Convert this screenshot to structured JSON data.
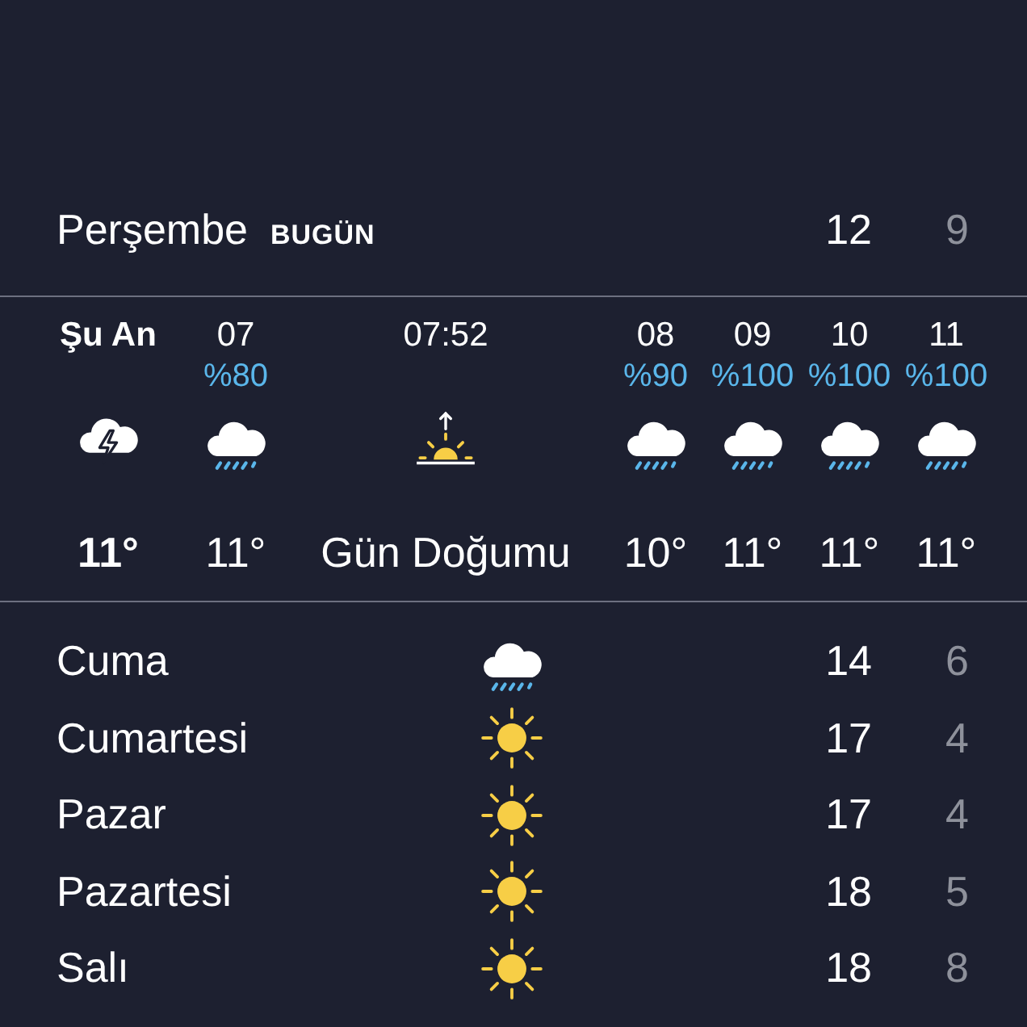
{
  "today": {
    "day": "Perşembe",
    "badge": "BUGÜN",
    "high": "12",
    "low": "9"
  },
  "hourly": [
    {
      "kind": "thunderstorm",
      "current": true,
      "time": "Şu An",
      "temp": "11°"
    },
    {
      "kind": "rain",
      "current": false,
      "time": "07",
      "chance": "%80",
      "temp": "11°"
    },
    {
      "kind": "sunrise",
      "current": false,
      "time": "07:52",
      "temp": "Gün Doğumu"
    },
    {
      "kind": "rain",
      "current": false,
      "time": "08",
      "chance": "%90",
      "temp": "10°"
    },
    {
      "kind": "rain",
      "current": false,
      "time": "09",
      "chance": "%100",
      "temp": "11°"
    },
    {
      "kind": "rain",
      "current": false,
      "time": "10",
      "chance": "%100",
      "temp": "11°"
    },
    {
      "kind": "rain",
      "current": false,
      "time": "11",
      "chance": "%100",
      "temp": "11°"
    }
  ],
  "daily": [
    {
      "kind": "rain",
      "day": "Cuma",
      "high": "14",
      "low": "6"
    },
    {
      "kind": "sun",
      "day": "Cumartesi",
      "high": "17",
      "low": "4"
    },
    {
      "kind": "sun",
      "day": "Pazar",
      "high": "17",
      "low": "4"
    },
    {
      "kind": "sun",
      "day": "Pazartesi",
      "high": "18",
      "low": "5"
    },
    {
      "kind": "sun",
      "day": "Salı",
      "high": "18",
      "low": "8"
    }
  ]
}
